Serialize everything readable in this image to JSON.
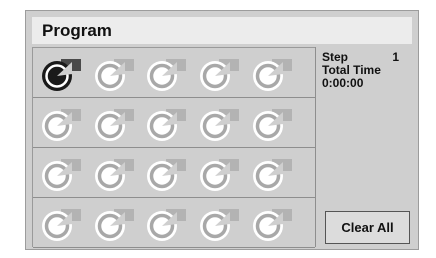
{
  "title": "Program",
  "info": {
    "step_label": "Step",
    "step_value": "1",
    "total_time_label": "Total Time",
    "total_time_value": "0:00:00"
  },
  "clear_all_label": "Clear All",
  "slots": [
    {
      "icon": "disc-icon",
      "state": "selected"
    },
    {
      "icon": "disc-icon",
      "state": "empty"
    },
    {
      "icon": "disc-icon",
      "state": "empty"
    },
    {
      "icon": "disc-icon",
      "state": "empty"
    },
    {
      "icon": "disc-icon",
      "state": "empty"
    },
    {
      "icon": "disc-icon",
      "state": "empty"
    },
    {
      "icon": "disc-icon",
      "state": "empty"
    },
    {
      "icon": "disc-icon",
      "state": "empty"
    },
    {
      "icon": "disc-icon",
      "state": "empty"
    },
    {
      "icon": "disc-icon",
      "state": "empty"
    },
    {
      "icon": "disc-icon",
      "state": "empty"
    },
    {
      "icon": "disc-icon",
      "state": "empty"
    },
    {
      "icon": "disc-icon",
      "state": "empty"
    },
    {
      "icon": "disc-icon",
      "state": "empty"
    },
    {
      "icon": "disc-icon",
      "state": "empty"
    },
    {
      "icon": "disc-icon",
      "state": "empty"
    },
    {
      "icon": "disc-icon",
      "state": "empty"
    },
    {
      "icon": "disc-icon",
      "state": "empty"
    },
    {
      "icon": "disc-icon",
      "state": "empty"
    },
    {
      "icon": "disc-icon",
      "state": "empty"
    }
  ],
  "colors": {
    "panel": "#cfcfcf",
    "title_bar": "#ececec",
    "disc_normal": "#ffffff",
    "disc_selected": "#1a1a1a",
    "tab_normal": "#b3b3b3",
    "tab_selected": "#4a4a4a"
  }
}
